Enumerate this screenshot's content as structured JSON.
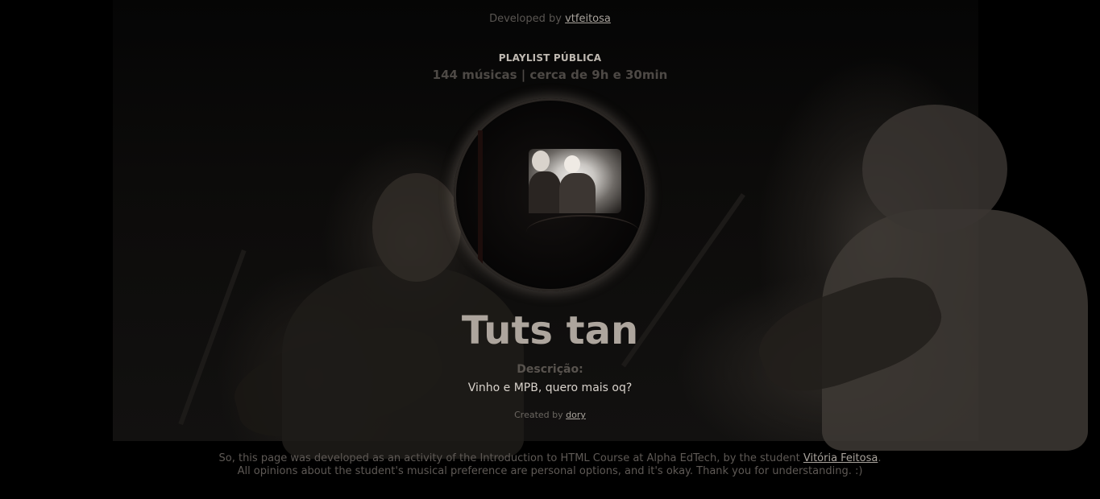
{
  "header": {
    "developed_by_prefix": "Developed by",
    "developer_link": "vtfeitosa"
  },
  "playlist": {
    "kicker": "PLAYLIST PÚBLICA",
    "stats": "144 músicas | cerca de 9h e 30min",
    "title": "Tuts tan",
    "description_label": "Descrição:",
    "description": "Vinho e MPB, quero mais oq?",
    "created_by_prefix": "Created by",
    "creator_link": "dory"
  },
  "footer": {
    "line1_prefix": "So, this page was developed as an activity of the Introduction to HTML Course at Alpha EdTech, by the student",
    "student_link": "Vitória Feitosa",
    "line1_suffix": ".",
    "line2": "All opinions about the student's musical preference are personal options, and it's okay. Thank you for understanding. :)"
  },
  "colors": {
    "background": "#000000",
    "title": "#ada59d",
    "link": "#a9a39c"
  }
}
